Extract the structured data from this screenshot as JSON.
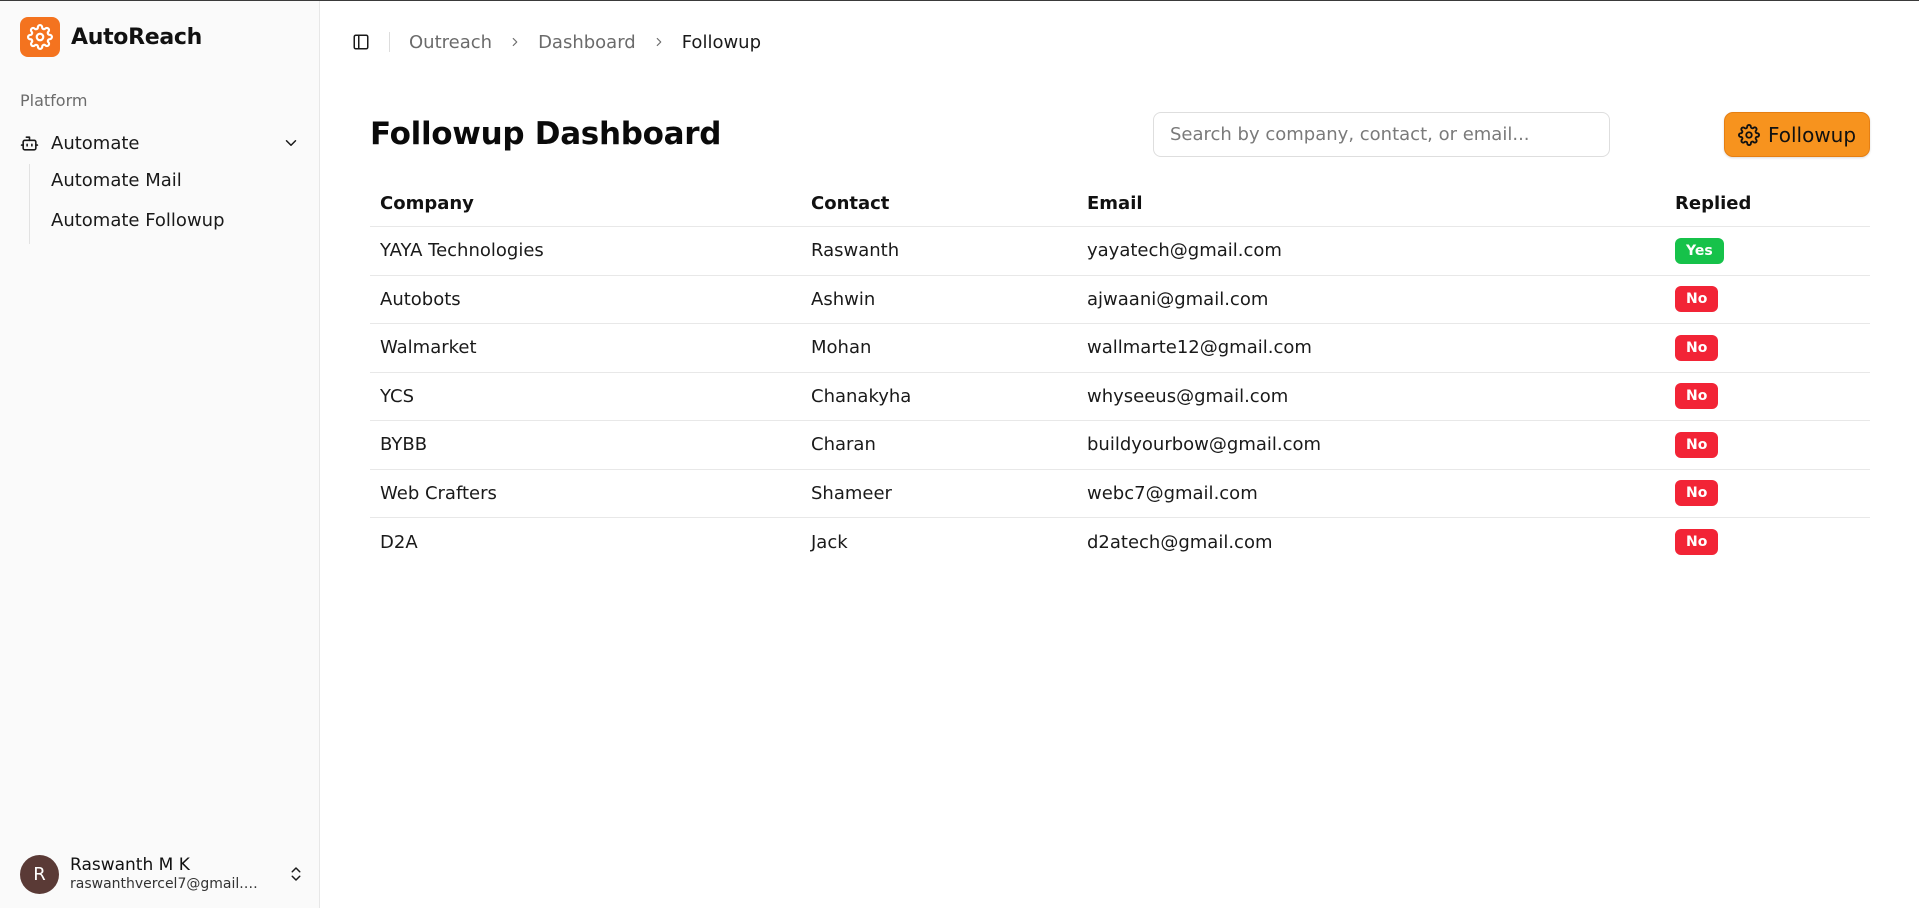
{
  "app": {
    "name": "AutoReach",
    "brand_color": "#f4731f",
    "logo_icon": "gear-icon"
  },
  "sidebar": {
    "group_label": "Platform",
    "nav": {
      "parent_label": "Automate",
      "parent_icon": "bot-icon",
      "expanded": true,
      "items": [
        {
          "label": "Automate Mail"
        },
        {
          "label": "Automate Followup"
        }
      ]
    },
    "user": {
      "initial": "R",
      "name": "Raswanth M K",
      "email": "raswanthvercel7@gmail.com"
    }
  },
  "breadcrumb": {
    "items": [
      "Outreach",
      "Dashboard",
      "Followup"
    ]
  },
  "page": {
    "title": "Followup Dashboard"
  },
  "search": {
    "placeholder": "Search by company, contact, or email...",
    "value": ""
  },
  "actions": {
    "followup_label": "Followup",
    "followup_color": "#f7931e"
  },
  "table": {
    "columns": [
      "Company",
      "Contact",
      "Email",
      "Replied"
    ],
    "rows": [
      {
        "company": "YAYA Technologies",
        "contact": "Raswanth",
        "email": "yayatech@gmail.com",
        "replied": "Yes"
      },
      {
        "company": "Autobots",
        "contact": "Ashwin",
        "email": "ajwaani@gmail.com",
        "replied": "No"
      },
      {
        "company": "Walmarket",
        "contact": "Mohan",
        "email": "wallmarte12@gmail.com",
        "replied": "No"
      },
      {
        "company": "YCS",
        "contact": "Chanakyha",
        "email": "whyseeus@gmail.com",
        "replied": "No"
      },
      {
        "company": "BYBB",
        "contact": "Charan",
        "email": "buildyourbow@gmail.com",
        "replied": "No"
      },
      {
        "company": "Web Crafters",
        "contact": "Shameer",
        "email": "webc7@gmail.com",
        "replied": "No"
      },
      {
        "company": "D2A",
        "contact": "Jack",
        "email": "d2atech@gmail.com",
        "replied": "No"
      }
    ],
    "status_colors": {
      "Yes": "#16c24a",
      "No": "#f22436"
    }
  }
}
